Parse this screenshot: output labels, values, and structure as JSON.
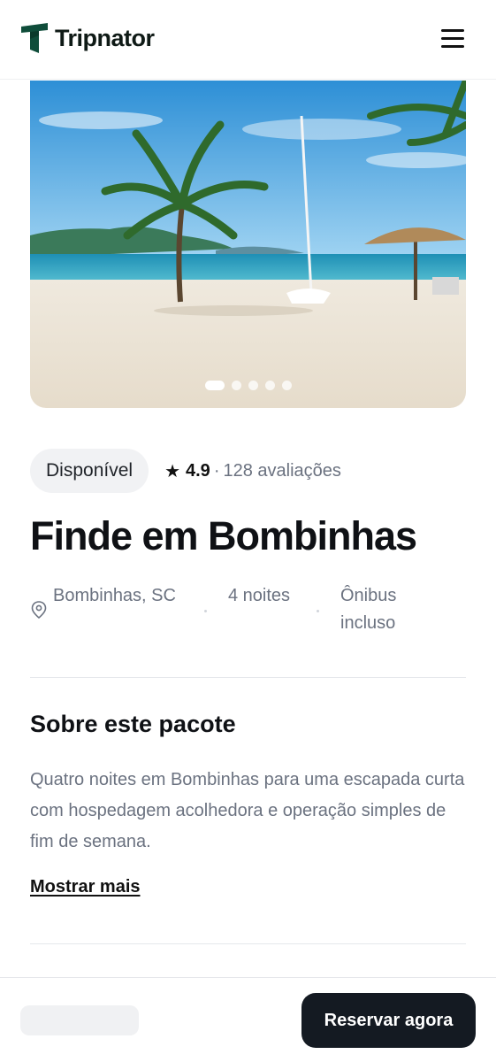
{
  "header": {
    "brand": "Tripnator",
    "logo_icon": "tripnator-logo",
    "menu_icon": "hamburger-menu-icon"
  },
  "gallery": {
    "image_description_icon": "beach-photo",
    "slides_count": 5,
    "active_slide": 1
  },
  "status": {
    "badge": "Disponível",
    "rating": "4.9",
    "separator": "·",
    "reviews": "128 avaliações"
  },
  "package": {
    "title": "Finde em Bombinhas",
    "facts": {
      "location": "Bombinhas, SC",
      "nights": "4 noites",
      "transport": "Ônibus incluso"
    }
  },
  "about": {
    "title": "Sobre este pacote",
    "text": "Quatro noites em Bombinhas para uma escapada curta com hospedagem acolhedora e operação simples de fim de semana.",
    "show_more": "Mostrar mais"
  },
  "footer": {
    "reserve_label": "Reservar agora"
  },
  "colors": {
    "brand": "#0f4d3a",
    "primary_button": "#141a22",
    "badge_bg": "#f1f2f4",
    "muted_text": "#6b7280"
  }
}
